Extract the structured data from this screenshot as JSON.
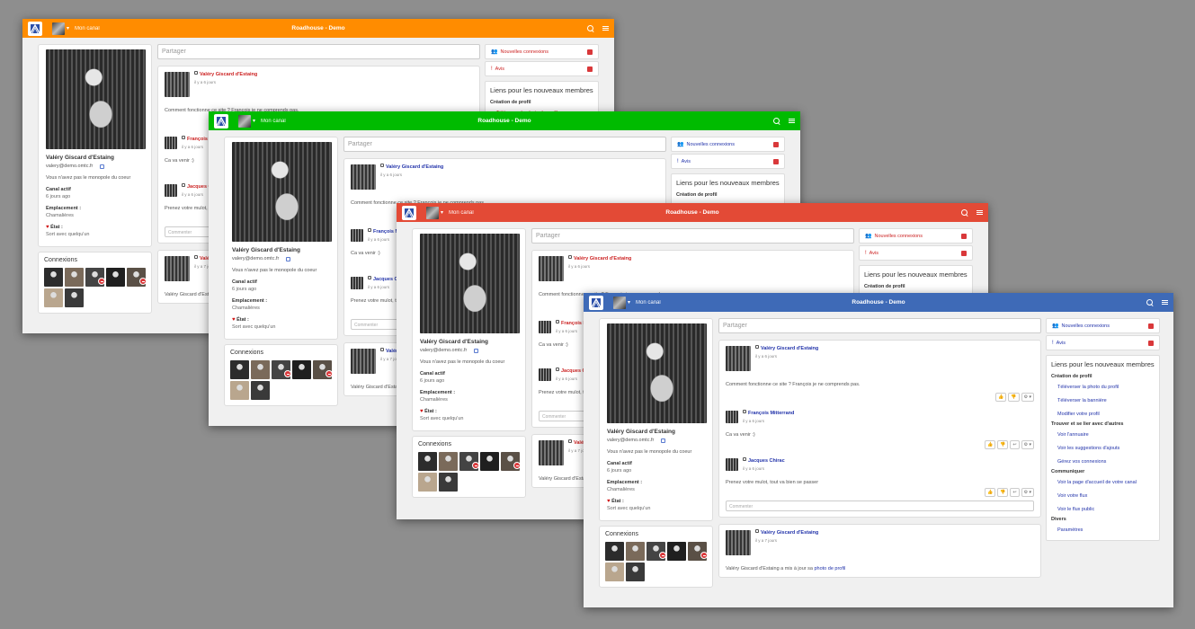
{
  "app": {
    "title": "Roadhouse - Demo",
    "channel_label": "Mon canal"
  },
  "windows": [
    {
      "id": "w1",
      "navbar_color": "#ff8c00",
      "link_color": "#cc2222"
    },
    {
      "id": "w2",
      "navbar_color": "#00bb00",
      "link_color": "#2233aa"
    },
    {
      "id": "w3",
      "navbar_color": "#e34a36",
      "link_color": "#cc2222"
    },
    {
      "id": "w4",
      "navbar_color": "#3e6ab7",
      "link_color": "#2233aa"
    }
  ],
  "profile": {
    "name": "Valéry Giscard d'Estaing",
    "email": "valery@demo.omtc.fr",
    "bio": "Vous n'avez pas le monopole du coeur",
    "active_label": "Canal actif",
    "active_value": "6 jours ago",
    "location_label": "Emplacement :",
    "location_value": "Chamalières",
    "state_label": "État :",
    "state_value": "Sort avec quelqu'un"
  },
  "connections": {
    "title": "Connexions",
    "count": 7
  },
  "share_placeholder": "Partager",
  "posts": [
    {
      "author": "Valéry Giscard d'Estaing",
      "time": "il y a 6 jours",
      "body": "Comment fonctionne ce site ? François je ne comprends pas.",
      "comments": [
        {
          "author": "François Mitterrand",
          "time": "il y a 6 jours",
          "body": "Ca va venir :)"
        },
        {
          "author": "Jacques Chirac",
          "time": "il y a 6 jours",
          "body": "Prenez votre mulot, tout va bien se passer"
        }
      ],
      "comment_placeholder": "Commenter"
    },
    {
      "author": "Valéry Giscard d'Estaing",
      "time": "il y a 7 jours",
      "update_prefix": "Valéry Giscard d'Estaing a mis à jour sa",
      "update_link": "photo de profil"
    }
  ],
  "notifications": [
    {
      "icon": "users-icon",
      "label": "Nouvelles connexions"
    },
    {
      "icon": "exclamation-icon",
      "label": "Avis"
    }
  ],
  "links_panel": {
    "title": "Liens pour les nouveaux membres",
    "sections": [
      {
        "title": "Création de profil",
        "items": [
          "Téléverser la photo du profil",
          "Téléverser la bannière",
          "Modifier votre profil"
        ]
      },
      {
        "title": "Trouver et se lier avec d'autres",
        "items": [
          "Voir l'annuaire",
          "Voir les suggestions d'ajouts",
          "Gérez vos connexions"
        ]
      },
      {
        "title": "Communiquer",
        "items": [
          "Voir la page d'accueil de votre canal",
          "Voir votre flux",
          "Voir le flux public"
        ]
      },
      {
        "title": "Divers",
        "items": [
          "Paramètres"
        ]
      }
    ]
  }
}
